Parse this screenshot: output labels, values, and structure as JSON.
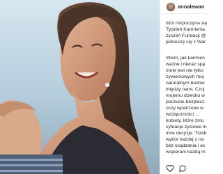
{
  "post": {
    "username": "annalewan",
    "caption_lines": [
      "dziś rozpoczyna się",
      "Tydzień Karmienia",
      "życzeń Fundacji @",
      "jednoczę się z War",
      "",
      "Wiem, jak karmien",
      "ważne i nieraz spę",
      "mnie jest nie tylko",
      "żywieniowych moj",
      "naturalnym budow",
      "między nami. Czuj",
      "mojemu dziecku w",
      "poczucie bezpiecz",
      "oczy wpatrzone w",
      "wdzięczności ...",
      "kobiety, które zmu",
      "sytuacje życiowe m",
      "inne decyzje. Trzeb",
      "wybór każdej z na",
      "bez osądzania i oc",
      "wspieram każdą m"
    ]
  },
  "colors": {
    "text": "#262626",
    "divider": "#efefef",
    "heart": "#262626"
  },
  "icons": [
    "heart-icon",
    "comment-icon"
  ]
}
